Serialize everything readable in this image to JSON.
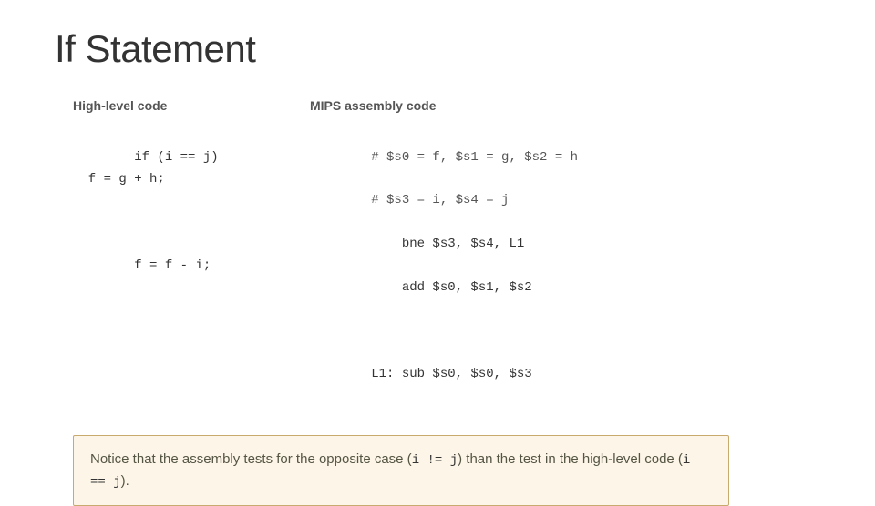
{
  "title": "If Statement",
  "left_column": {
    "label": "High-level code",
    "code_block1": "if (i == j)\n  f = g + h;",
    "code_block2": "f = f - i;"
  },
  "right_column": {
    "label": "MIPS assembly code",
    "comment1": "# $s0 = f, $s1 = g, $s2 = h",
    "comment2": "# $s3 = i, $s4 = j",
    "code1": "    bne $s3, $s4, L1",
    "code2": "    add $s0, $s1, $s2",
    "code3": "L1: sub $s0, $s0, $s3"
  },
  "notice": {
    "text_before": "Notice that the assembly tests for the opposite case (",
    "inline_code1": "i != j",
    "text_middle": ") than the test in the high-level code (",
    "inline_code2": "i == j",
    "text_after": ")."
  }
}
